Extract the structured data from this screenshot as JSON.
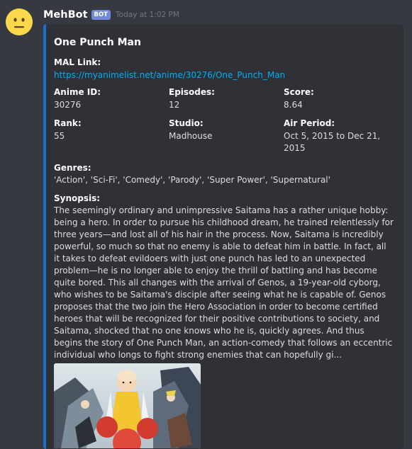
{
  "message": {
    "username": "MehBot",
    "bot_tag": "BOT",
    "timestamp": "Today at 1:02 PM",
    "avatar_icon": "neutral-face-icon"
  },
  "embed": {
    "accent_color": "#1a6fd1",
    "title": "One Punch Man",
    "mal": {
      "name": "MAL Link:",
      "url": "https://myanimelist.net/anime/30276/One_Punch_Man"
    },
    "fields": {
      "anime_id": {
        "name": "Anime ID:",
        "value": "30276"
      },
      "episodes": {
        "name": "Episodes:",
        "value": "12"
      },
      "score": {
        "name": "Score:",
        "value": "8.64"
      },
      "rank": {
        "name": "Rank:",
        "value": "55"
      },
      "studio": {
        "name": "Studio:",
        "value": "Madhouse"
      },
      "air_period": {
        "name": "Air Period:",
        "value": "Oct 5, 2015 to Dec 21, 2015"
      }
    },
    "genres": {
      "name": "Genres:",
      "value": "'Action', 'Sci-Fi', 'Comedy', 'Parody', 'Super Power', 'Supernatural'"
    },
    "synopsis": {
      "name": "Synopsis:",
      "value": "The seemingly ordinary and unimpressive Saitama has a rather unique hobby: being a hero. In order to pursue his childhood dream, he trained relentlessly for three years—and lost all of his hair in the process. Now, Saitama is incredibly powerful, so much so that no enemy is able to defeat him in battle. In fact, all it takes to defeat evildoers with just one punch has led to an unexpected problem—he is no longer able to enjoy the thrill of battling and has become quite bored. This all changes with the arrival of Genos, a 19-year-old cyborg, who wishes to be Saitama's disciple after seeing what he is capable of. Genos proposes that the two join the Hero Association in order to become certified heroes that will be recognized for their positive contributions to society, and Saitama, shocked that no one knows who he is, quickly agrees. And thus begins the story of One Punch Man, an action-comedy that follows an eccentric individual who longs to fight strong enemies that can hopefully gi..."
    }
  }
}
